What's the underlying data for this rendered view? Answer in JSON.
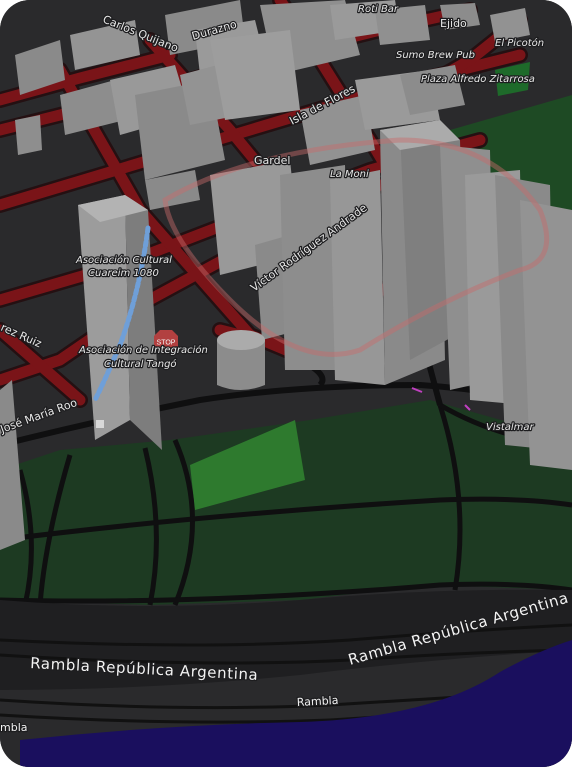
{
  "map": {
    "streets": {
      "carlos_quijano": "Carlos Quijano",
      "durazno": "Durazno",
      "ejido": "Ejido",
      "isla_de_flores": "Isla de Flores",
      "gardel": "Gardel",
      "victor_rodriguez_andrade": "Víctor Rodríguez Andrade",
      "juarez_ruiz": "rez Ruiz",
      "jose_maria_roo": "José María Roo",
      "rambla_republica_argentina_1": "Rambla República Argentina",
      "rambla_republica_argentina_2": "Rambla República Argentina",
      "rambla_lower": "Rambla",
      "rambla_left": "mbla"
    },
    "pois": {
      "roti_bar": "Roti Bar",
      "sumo_brew_pub": "Sumo Brew Pub",
      "el_picoton": "El Picotón",
      "plaza_alfredo_zitarrosa": "Plaza Alfredo Zitarrosa",
      "la_moni": "La Moni",
      "asociacion_cultural_1": "Asociación Cultural",
      "asociacion_cultural_2": "Cuareim 1080",
      "asociacion_integracion_1": "Asociación de Integración",
      "asociacion_integracion_2": "Cultural Tangó",
      "vistalmar": "Vistalmar",
      "stop_sign": "STOP"
    },
    "colors": {
      "ground": "#2a2a2c",
      "road_fill": "#7a1418",
      "road_casing": "#241012",
      "building": "#8c8c8c",
      "park": "#1e4a24",
      "park_bright": "#2e7a2e",
      "water": "#1a0f5e",
      "route": "#6f9fd8"
    }
  }
}
